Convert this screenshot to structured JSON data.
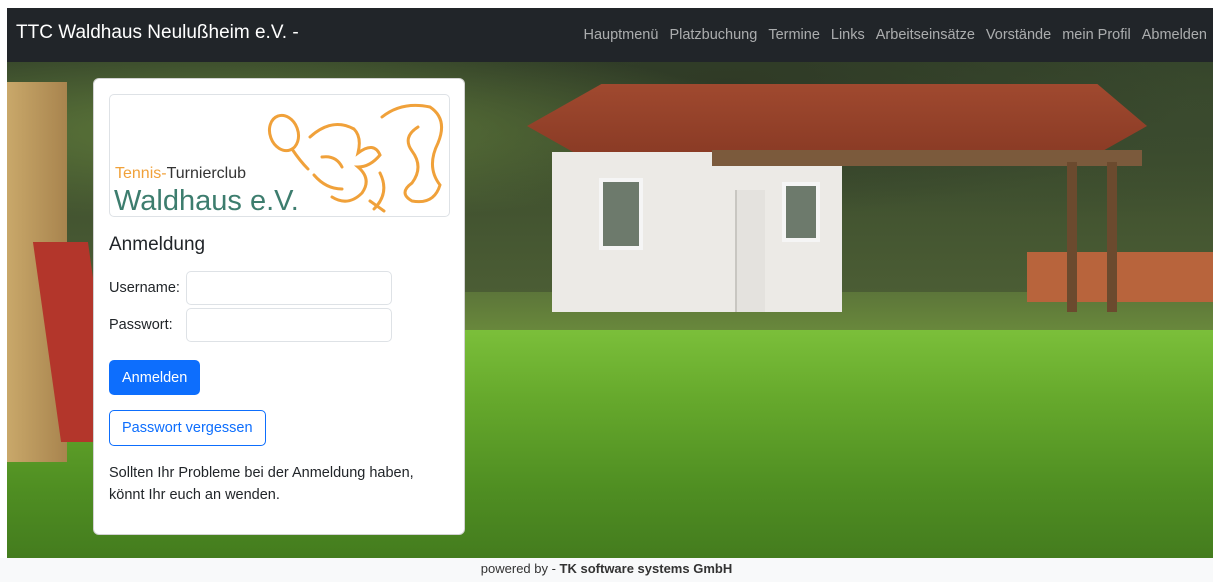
{
  "navbar": {
    "brand": "TTC Waldhaus Neulußheim e.V. -",
    "items": [
      {
        "label": "Hauptmenü"
      },
      {
        "label": "Platzbuchung"
      },
      {
        "label": "Termine"
      },
      {
        "label": "Links"
      },
      {
        "label": "Arbeitseinsätze"
      },
      {
        "label": "Vorstände"
      },
      {
        "label": "mein Profil"
      },
      {
        "label": "Abmelden"
      }
    ]
  },
  "logo": {
    "sub_prefix": "Tennis-",
    "sub_suffix": "Turnierclub",
    "main": "Waldhaus e.V.",
    "accent_color": "#f0a13a",
    "main_color": "#3d7d6e"
  },
  "login": {
    "title": "Anmeldung",
    "username_label": "Username:",
    "username_value": "",
    "password_label": "Passwort:",
    "password_value": "",
    "submit_label": "Anmelden",
    "forgot_label": "Passwort vergessen",
    "help_text": "Sollten Ihr Probleme bei der Anmeldung haben, könnt Ihr euch an wenden."
  },
  "footer": {
    "prefix": "powered by - ",
    "company": "TK software systems GmbH"
  },
  "colors": {
    "navbar_bg": "#212529",
    "primary": "#0d6efd"
  }
}
